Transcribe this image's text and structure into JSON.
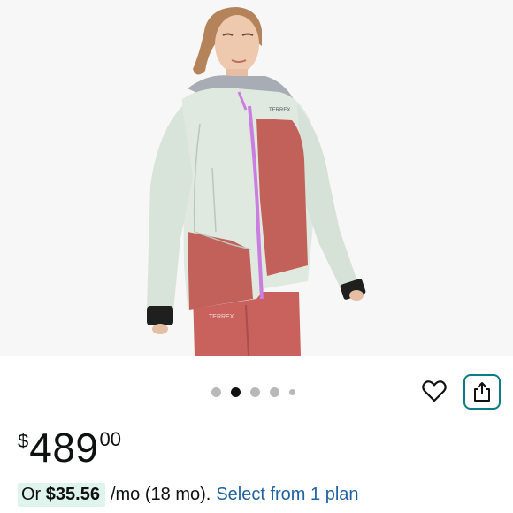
{
  "product": {
    "image_alt": "Product photo of woman wearing a jacket",
    "jacket_brand_text": "TERREX",
    "colors": {
      "jacket_main": "#dfe9e0",
      "jacket_panel": "#c2605a",
      "zipper": "#c97ee0",
      "background": "#f7f7f7"
    }
  },
  "carousel": {
    "dot_count": 5,
    "active_index": 1
  },
  "actions": {
    "wishlist_icon": "heart-outline-icon",
    "share_icon": "share-icon",
    "share_border_color": "#0a7c86"
  },
  "price": {
    "symbol": "$",
    "whole": "489",
    "fraction": "00"
  },
  "installment": {
    "prefix": "Or ",
    "amount": "$35.56",
    "term": "/mo (18 mo).",
    "link": "Select from 1 plan",
    "highlight_color": "#dff4ec",
    "link_color": "#2162a1"
  }
}
